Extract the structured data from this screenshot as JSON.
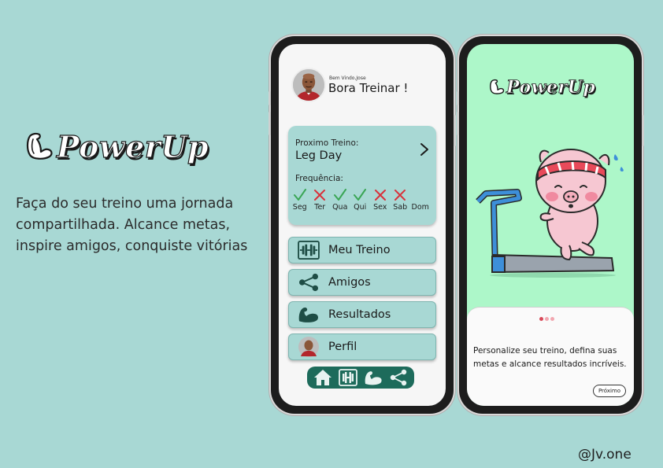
{
  "brand": {
    "name": "PowerUp"
  },
  "hero": {
    "tagline": "Faça do seu treino uma jornada compartilhada. Alcance metas, inspire amigos, conquiste vitórias"
  },
  "credit": "@Jv.one",
  "home_screen": {
    "welcome": "Bem Vindo,Jose",
    "greeting": "Bora Treinar !",
    "next_workout": {
      "label": "Proximo Treino:",
      "name": "Leg Day",
      "frequency_label": "Frequência:",
      "days": [
        {
          "name": "Seg",
          "status": "done"
        },
        {
          "name": "Ter",
          "status": "missed"
        },
        {
          "name": "Qua",
          "status": "done"
        },
        {
          "name": "Qui",
          "status": "done"
        },
        {
          "name": "Sex",
          "status": "missed"
        },
        {
          "name": "Sab",
          "status": "missed"
        },
        {
          "name": "Dom",
          "status": "none"
        }
      ]
    },
    "menu": [
      {
        "label": "Meu Treino",
        "icon": "dumbbell-icon"
      },
      {
        "label": "Amigos",
        "icon": "share-icon"
      },
      {
        "label": "Resultados",
        "icon": "bicep-icon"
      },
      {
        "label": "Perfil",
        "icon": "avatar"
      }
    ],
    "nav": [
      "home-icon",
      "dumbbell-icon",
      "bicep-icon",
      "share-icon"
    ]
  },
  "onboarding_screen": {
    "description": "Personalize seu treino, defina suas metas e alcance resultados incríveis.",
    "next_label": "Próximo",
    "page_dots": 3,
    "active_dot": 0
  },
  "colors": {
    "background": "#a8d8d4",
    "accent_dark": "#1d6b5b",
    "onboarding_bg": "#adf7c9",
    "check": "#3aa655",
    "cross": "#d8323a",
    "dot_active": "#d84a5a",
    "dot_inactive": "#f2a7b0"
  }
}
